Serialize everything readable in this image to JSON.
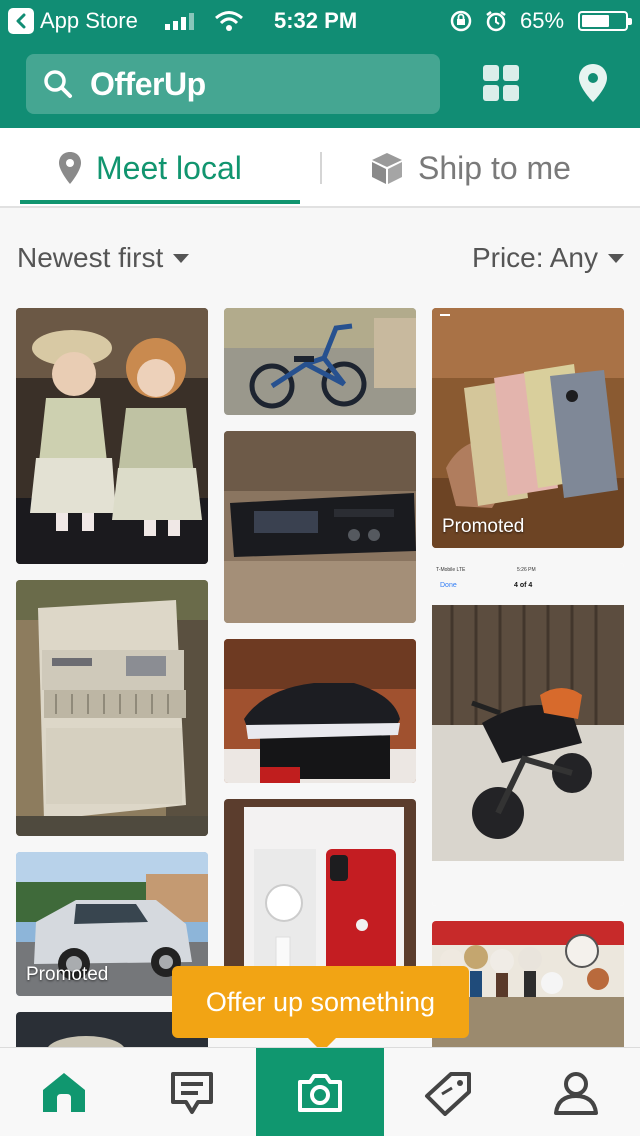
{
  "status_bar": {
    "back_label": "App Store",
    "time": "5:32 PM",
    "battery": "65%",
    "battery_level": 0.65
  },
  "header": {
    "brand": "OfferUp",
    "icons": [
      "search-icon",
      "grid-icon",
      "location-pin-icon"
    ]
  },
  "tabs": [
    {
      "label": "Meet local",
      "icon": "location-pin-icon",
      "active": true
    },
    {
      "label": "Ship to me",
      "icon": "box-icon",
      "active": false
    }
  ],
  "filters": {
    "sort_label": "Newest first",
    "price_label": "Price: Any"
  },
  "listings": [
    {
      "name": "porcelain-dolls",
      "promoted": false
    },
    {
      "name": "bmx-bike",
      "promoted": false
    },
    {
      "name": "iphones",
      "promoted": true,
      "badge": "Promoted"
    },
    {
      "name": "car-stereo",
      "promoted": false
    },
    {
      "name": "air-conditioner",
      "promoted": false
    },
    {
      "name": "sneakers",
      "promoted": false
    },
    {
      "name": "mini-motorcycle",
      "promoted": false,
      "screenshot_text": {
        "carrier": "T-Mobile LTE",
        "time": "5:26 PM",
        "done": "Done",
        "counter": "4 of 4"
      }
    },
    {
      "name": "silver-suv",
      "promoted": true,
      "badge": "Promoted"
    },
    {
      "name": "red-iphone",
      "promoted": false
    },
    {
      "name": "figurines",
      "promoted": false
    }
  ],
  "tooltip": {
    "text": "Offer up something"
  },
  "bottom_nav": [
    "home-icon",
    "messages-icon",
    "camera-icon",
    "tag-icon",
    "profile-icon"
  ],
  "colors": {
    "brand": "#118d74",
    "accent": "#11956f",
    "tooltip": "#f2a414"
  }
}
